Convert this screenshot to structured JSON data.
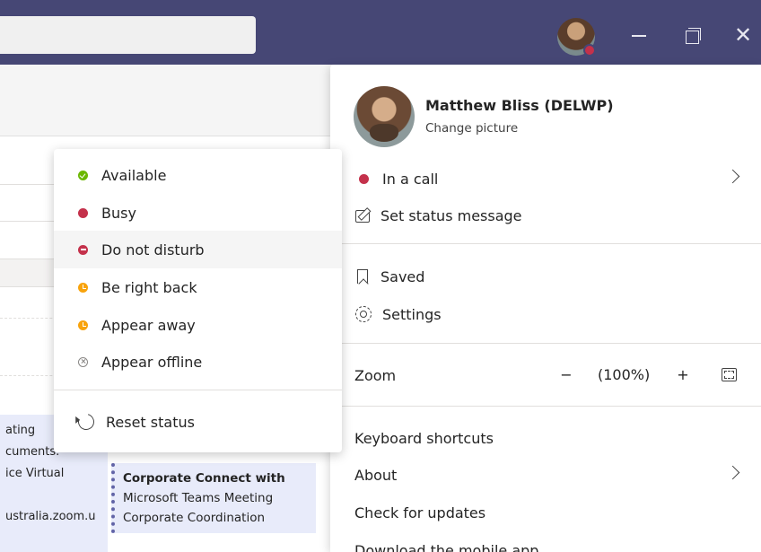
{
  "titlebar": {
    "avatar_presence": "busy",
    "window_controls": [
      "minimize",
      "restore",
      "close"
    ]
  },
  "background": {
    "calendar_left_lines": [
      "ating",
      "cuments.",
      "ice Virtual",
      "ustralia.zoom.u"
    ],
    "event": {
      "title": "Corporate Connect with",
      "line2": "Microsoft Teams Meeting",
      "line3": "Corporate Coordination"
    }
  },
  "status_menu": {
    "items": [
      {
        "label": "Available",
        "icon": "available-icon",
        "color": "#6bb700"
      },
      {
        "label": "Busy",
        "icon": "busy-icon",
        "color": "#c4314b"
      },
      {
        "label": "Do not disturb",
        "icon": "do-not-disturb-icon",
        "color": "#c4314b"
      },
      {
        "label": "Be right back",
        "icon": "be-right-back-icon",
        "color": "#f8a30c"
      },
      {
        "label": "Appear away",
        "icon": "appear-away-icon",
        "color": "#f8a30c"
      },
      {
        "label": "Appear offline",
        "icon": "appear-offline-icon",
        "color": "#8a8886"
      }
    ],
    "highlighted": "Do not disturb",
    "reset_label": "Reset status"
  },
  "profile": {
    "name": "Matthew Bliss (DELWP)",
    "change_picture": "Change picture",
    "current_status": "In a call",
    "set_status_message": "Set status message",
    "saved": "Saved",
    "settings": "Settings",
    "zoom_label": "Zoom",
    "zoom_minus": "−",
    "zoom_value": "(100%)",
    "zoom_plus": "+",
    "keyboard_shortcuts": "Keyboard shortcuts",
    "about": "About",
    "check_updates": "Check for updates",
    "download_mobile": "Download the mobile app"
  },
  "colors": {
    "titlebar": "#464775",
    "busy": "#c4314b",
    "available": "#6bb700",
    "away": "#f8a30c"
  }
}
